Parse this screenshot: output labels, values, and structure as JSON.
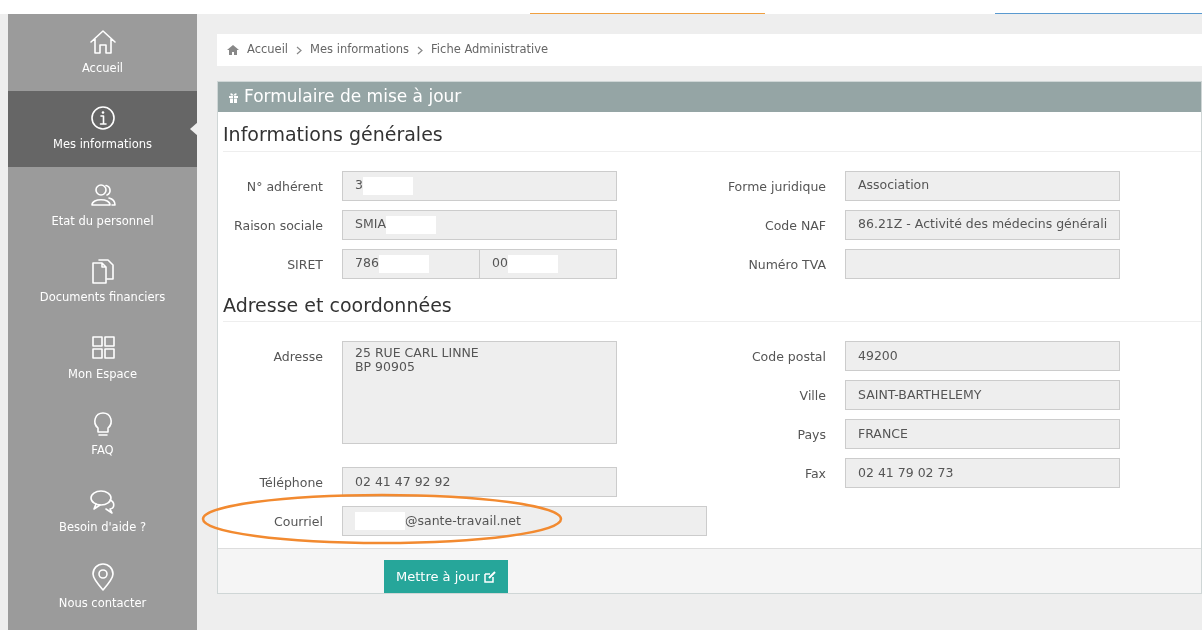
{
  "sidebar": {
    "items": [
      {
        "label": "Accueil",
        "selected": false
      },
      {
        "label": "Mes informations",
        "selected": true
      },
      {
        "label": "Etat du personnel",
        "selected": false
      },
      {
        "label": "Documents financiers",
        "selected": false
      },
      {
        "label": "Mon Espace",
        "selected": false
      },
      {
        "label": "FAQ",
        "selected": false
      },
      {
        "label": "Besoin d'aide ?",
        "selected": false
      },
      {
        "label": "Nous contacter",
        "selected": false
      }
    ]
  },
  "breadcrumb": [
    "Accueil",
    "Mes informations",
    "Fiche Administrative"
  ],
  "panel": {
    "title": "Formulaire de mise à jour",
    "sections": [
      {
        "title": "Informations générales",
        "left": [
          {
            "label": "N° adhérent",
            "parts": [
              {
                "text": "3",
                "redacted_after": true
              }
            ]
          },
          {
            "label": "Raison sociale",
            "parts": [
              {
                "text": "SMIA",
                "redacted_after": true
              }
            ]
          },
          {
            "label": "SIRET",
            "parts": [
              {
                "text": "786",
                "redacted_after": true
              },
              {
                "text": "00",
                "redacted_after": true
              }
            ]
          }
        ],
        "right": [
          {
            "label": "Forme juridique",
            "parts": [
              {
                "text": "Association"
              }
            ]
          },
          {
            "label": "Code NAF",
            "parts": [
              {
                "text": "86.21Z - Activité des médecins générali"
              }
            ]
          },
          {
            "label": "Numéro TVA"
          }
        ]
      },
      {
        "title": "Adresse et coordonnées",
        "left": [
          {
            "label": "Adresse",
            "kind": "textarea",
            "lines": [
              "25 RUE CARL LINNE",
              "BP 90905"
            ]
          },
          {
            "label": "Téléphone",
            "parts": [
              {
                "text": "02 41 47 92 92"
              }
            ]
          },
          {
            "label": "Courriel",
            "kind": "wide",
            "highlighted": true,
            "parts": [
              {
                "text": "@sante-travail.net",
                "redacted_before": true
              }
            ]
          }
        ],
        "right": [
          {
            "label": "Code postal",
            "parts": [
              {
                "text": "49200"
              }
            ]
          },
          {
            "label": "Ville",
            "parts": [
              {
                "text": "SAINT-BARTHELEMY"
              }
            ]
          },
          {
            "label": "Pays",
            "parts": [
              {
                "text": "FRANCE"
              }
            ]
          },
          {
            "label": "Fax",
            "parts": [
              {
                "text": "02 41 79 02 73"
              }
            ]
          }
        ]
      }
    ],
    "button": "Mettre à jour"
  }
}
